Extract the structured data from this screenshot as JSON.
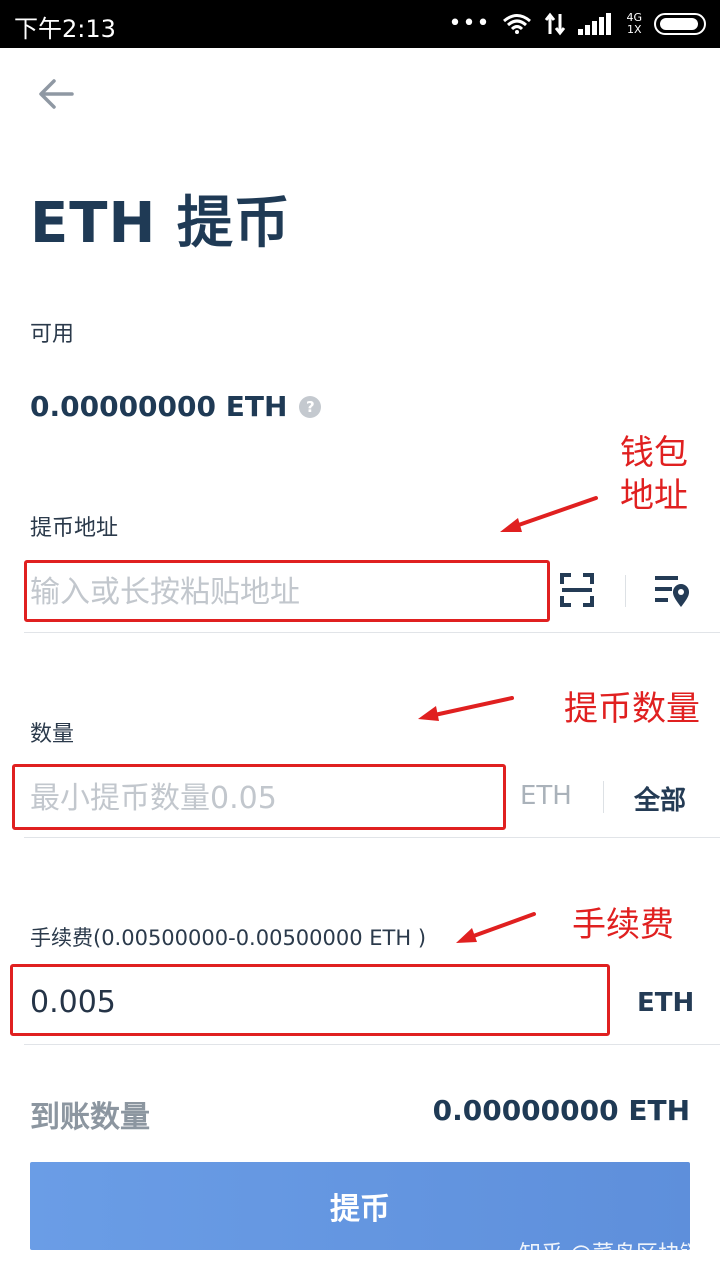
{
  "status_bar": {
    "time": "下午2:13",
    "network": "4G",
    "network_sub": "1X"
  },
  "page": {
    "title": "ETH 提币"
  },
  "balance": {
    "label": "可用",
    "value": "0.00000000 ETH"
  },
  "address": {
    "label": "提币地址",
    "placeholder": "输入或长按粘贴地址",
    "value": ""
  },
  "amount": {
    "label": "数量",
    "placeholder": "最小提币数量0.05",
    "unit": "ETH",
    "all_label": "全部"
  },
  "fee": {
    "label": "手续费(0.00500000-0.00500000 ETH )",
    "value": "0.005",
    "unit": "ETH"
  },
  "received": {
    "label": "到账数量",
    "value": "0.00000000 ETH"
  },
  "submit": {
    "label": "提币"
  },
  "annotations": {
    "wallet_address": "钱包\n地址",
    "quantity": "提币数量",
    "fee": "手续费"
  },
  "watermark": "知乎 @菜鸟区块链",
  "colors": {
    "annotation": "#e02020",
    "button": "#6a9de6",
    "title": "#1f3a55"
  }
}
